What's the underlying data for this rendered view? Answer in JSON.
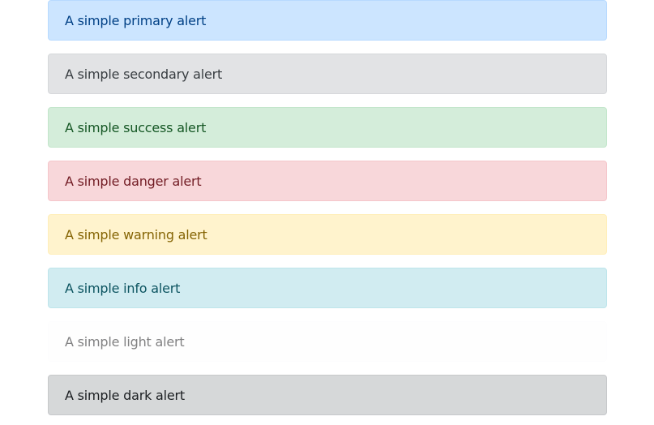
{
  "alerts": [
    {
      "type": "primary",
      "text": "A simple primary alert",
      "bg": "#cce5ff",
      "border": "#b8daff",
      "color": "#004085"
    },
    {
      "type": "secondary",
      "text": "A simple secondary alert",
      "bg": "#e2e3e5",
      "border": "#d6d8db",
      "color": "#383d41"
    },
    {
      "type": "success",
      "text": "A simple success alert",
      "bg": "#d4edda",
      "border": "#c3e6cb",
      "color": "#155724"
    },
    {
      "type": "danger",
      "text": "A simple danger alert",
      "bg": "#f8d7da",
      "border": "#f5c6cb",
      "color": "#721c24"
    },
    {
      "type": "warning",
      "text": "A simple warning alert",
      "bg": "#fff3cd",
      "border": "#ffeeba",
      "color": "#856404"
    },
    {
      "type": "info",
      "text": "A simple info alert",
      "bg": "#d1ecf1",
      "border": "#bee5eb",
      "color": "#0c5460"
    },
    {
      "type": "light",
      "text": "A simple light alert",
      "bg": "#fefefe",
      "border": "#fdfdfe",
      "color": "#818182"
    },
    {
      "type": "dark",
      "text": "A simple dark alert",
      "bg": "#d6d8d9",
      "border": "#c6c8ca",
      "color": "#1b1e21"
    }
  ]
}
